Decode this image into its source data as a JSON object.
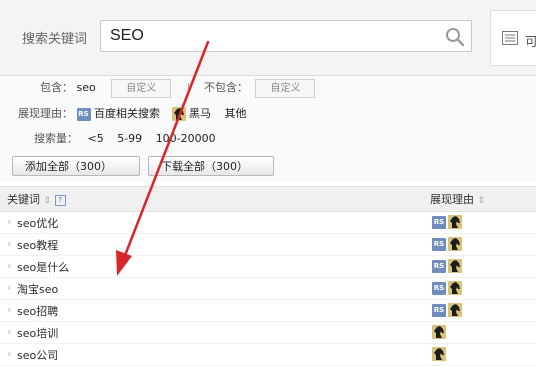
{
  "search": {
    "label": "搜索关键词",
    "value": "SEO"
  },
  "side_tab": {
    "label": "可"
  },
  "filters": {
    "include_label": "包含：",
    "include_value": "seo",
    "custom_label": "自定义",
    "separator": "|",
    "exclude_label": "不包含：",
    "exclude_custom_label": "自定义",
    "reason_label": "展现理由：",
    "reason_options": [
      {
        "icon": "rs-badge-icon",
        "icon_text": "RS",
        "label": "百度相关搜索"
      },
      {
        "icon": "dark-horse-icon",
        "label": "黑马"
      },
      {
        "label": "其他"
      }
    ],
    "volume_label": "搜索量：",
    "volume_options": [
      "<5",
      "5-99",
      "100-20000"
    ]
  },
  "actions": {
    "add_all": "添加全部（300）",
    "download_all": "下载全部（300）"
  },
  "table": {
    "col_keyword": "关键词",
    "col_reason": "展现理由",
    "help_glyph": "?",
    "rows": [
      {
        "keyword": "seo优化",
        "reasons": [
          "rs",
          "horse"
        ]
      },
      {
        "keyword": "seo教程",
        "reasons": [
          "rs",
          "horse"
        ]
      },
      {
        "keyword": "seo是什么",
        "reasons": [
          "rs",
          "horse"
        ]
      },
      {
        "keyword": "淘宝seo",
        "reasons": [
          "rs",
          "horse"
        ]
      },
      {
        "keyword": "seo招聘",
        "reasons": [
          "rs",
          "horse"
        ]
      },
      {
        "keyword": "seo培训",
        "reasons": [
          "horse"
        ]
      },
      {
        "keyword": "seo公司",
        "reasons": [
          "horse"
        ]
      }
    ]
  },
  "colors": {
    "arrow": "#d6262b",
    "rs_badge": "#6f8ebf",
    "horse_badge": "#d9c37a"
  }
}
